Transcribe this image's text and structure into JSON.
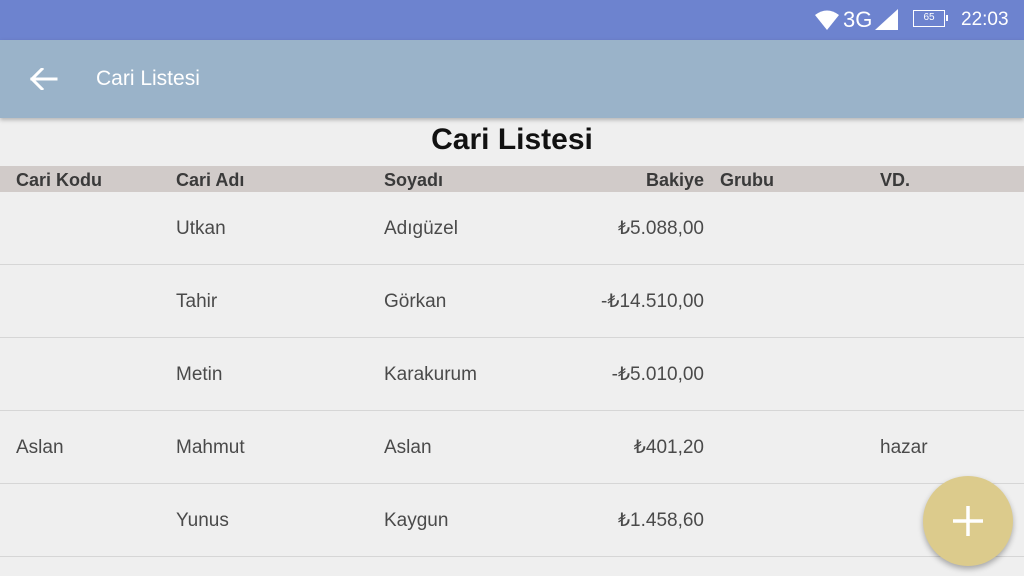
{
  "status_bar": {
    "network": "3G",
    "battery": "65",
    "time": "22:03",
    "icons": [
      "wifi-icon",
      "signal-icon",
      "battery-icon"
    ]
  },
  "app_bar": {
    "title": "Cari Listesi",
    "back_icon": "arrow-left-icon"
  },
  "page": {
    "title": "Cari Listesi"
  },
  "table": {
    "headers": {
      "kod": "Cari Kodu",
      "ad": "Cari Adı",
      "soyad": "Soyadı",
      "bakiye": "Bakiye",
      "grubu": "Grubu",
      "vd": "VD."
    },
    "rows": [
      {
        "kod": "",
        "ad": "Utkan",
        "soyad": "Adıgüzel",
        "bakiye": "₺5.088,00",
        "grubu": "",
        "vd": ""
      },
      {
        "kod": "",
        "ad": "Tahir",
        "soyad": "Görkan",
        "bakiye": "-₺14.510,00",
        "grubu": "",
        "vd": ""
      },
      {
        "kod": "",
        "ad": "Metin",
        "soyad": "Karakurum",
        "bakiye": "-₺5.010,00",
        "grubu": "",
        "vd": ""
      },
      {
        "kod": "Aslan",
        "ad": "Mahmut",
        "soyad": "Aslan",
        "bakiye": "₺401,20",
        "grubu": "",
        "vd": "hazar"
      },
      {
        "kod": "",
        "ad": "Yunus",
        "soyad": "Kaygun",
        "bakiye": "₺1.458,60",
        "grubu": "",
        "vd": ""
      }
    ]
  },
  "fab": {
    "icon": "plus-icon"
  },
  "colors": {
    "status_bar": "#6d83cf",
    "app_bar": "#9ab3c9",
    "table_header": "#d1cbc9",
    "fab": "#dccb8c",
    "background": "#efefef"
  }
}
